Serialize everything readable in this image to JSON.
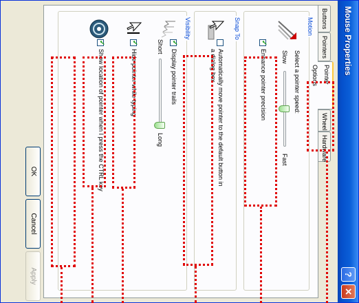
{
  "window": {
    "title": "Mouse Properties",
    "help_icon": "?",
    "close_icon": "✕"
  },
  "tabs": [
    {
      "label": "Buttons"
    },
    {
      "label": "Pointers"
    },
    {
      "label": "Pointer Options"
    },
    {
      "label": "Wheel"
    },
    {
      "label": "Hardware"
    }
  ],
  "active_tab": "Pointer Options",
  "motion": {
    "group_label": "Motion",
    "speed_label": "Select a pointer speed:",
    "slow_label": "Slow",
    "fast_label": "Fast",
    "speed_value": 0.5,
    "precision_label": "Enhance pointer precision",
    "precision_checked": true
  },
  "snap_to": {
    "group_label": "Snap To",
    "auto_move_label": "Automatically move pointer to the default button in a dialog box",
    "auto_move_checked": false
  },
  "visibility": {
    "group_label": "Visibility",
    "trails_label": "Display pointer trails",
    "trails_checked": true,
    "short_label": "Short",
    "long_label": "Long",
    "trail_length_value": 1.0,
    "hide_typing_label": "Hide pointer while typing",
    "hide_typing_checked": true,
    "ctrl_label": "Show location of pointer when I press the CTRL key",
    "ctrl_checked": true
  },
  "buttons": {
    "ok": "OK",
    "cancel": "Cancel",
    "apply": "Apply"
  },
  "highlight_color": "#e00000"
}
